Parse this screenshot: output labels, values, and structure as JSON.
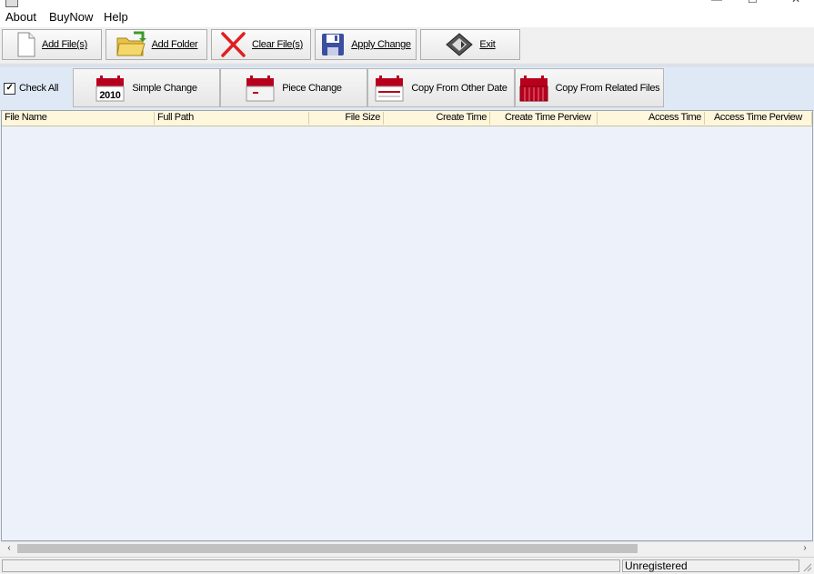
{
  "menu": [
    "About",
    "BuyNow",
    "Help"
  ],
  "toolbar": {
    "add_files": "Add File(s)",
    "add_folder": "Add Folder",
    "clear_files": "Clear File(s)",
    "apply_change": "Apply Change",
    "exit": "Exit"
  },
  "toolbar2": {
    "check_all": "Check All",
    "check_all_checked": true,
    "simple_change": "Simple Change",
    "simple_change_year": "2010",
    "piece_change": "Piece Change",
    "copy_other_date": "Copy From Other Date",
    "copy_related_files": "Copy From Related Files"
  },
  "columns": [
    "File Name",
    "Full Path",
    "File Size",
    "Create Time",
    "Create Time Perview",
    "Access Time",
    "Access Time Perview"
  ],
  "status": {
    "registration": "Unregistered"
  },
  "colors": {
    "list_bg": "#edf2fa",
    "header_bg": "#fff7dc",
    "toolbar2_bg": "#dfe9f6",
    "calendar_red": "#b8001c"
  }
}
